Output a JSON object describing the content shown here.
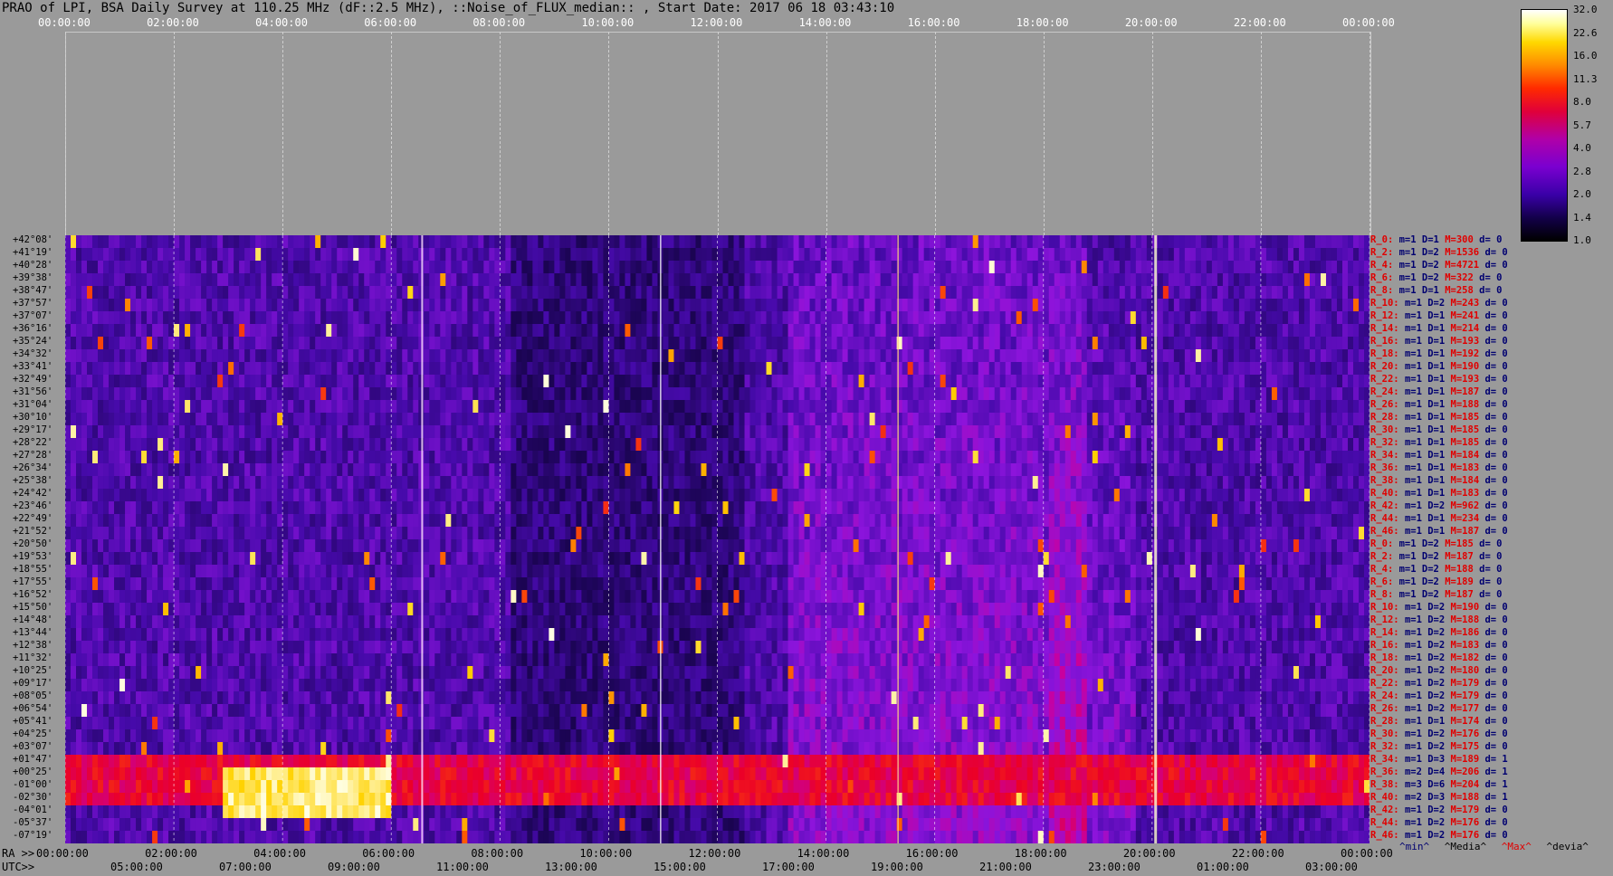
{
  "title": "PRAO of LPI, BSA Daily Survey at 110.25 MHz (dF::2.5 MHz), ::Noise_of_FLUX_median:: , Start Date: 2017 06 18 03:43:10",
  "colors": {
    "background": "#9a9a9a",
    "plot_bg": "#1a0650",
    "label_red": "#e00000",
    "label_blue": "#000070"
  },
  "chart_data": {
    "type": "heatmap",
    "top_axis_ticks": [
      "00:00:00",
      "02:00:00",
      "04:00:00",
      "06:00:00",
      "08:00:00",
      "10:00:00",
      "12:00:00",
      "14:00:00",
      "16:00:00",
      "18:00:00",
      "20:00:00",
      "22:00:00",
      "00:00:00"
    ],
    "ra_prefix": "RA >>",
    "ra_ticks": [
      "00:00:00",
      "02:00:00",
      "04:00:00",
      "06:00:00",
      "08:00:00",
      "10:00:00",
      "12:00:00",
      "14:00:00",
      "16:00:00",
      "18:00:00",
      "20:00:00",
      "22:00:00",
      "00:00:00"
    ],
    "utc_prefix": "UTC>>",
    "utc_ticks": [
      "05:00:00",
      "07:00:00",
      "09:00:00",
      "11:00:00",
      "13:00:00",
      "15:00:00",
      "17:00:00",
      "19:00:00",
      "21:00:00",
      "23:00:00",
      "01:00:00",
      "03:00:00"
    ],
    "color_scale": [
      "32.0",
      "22.6",
      "16.0",
      "11.3",
      "8.0",
      "5.7",
      "4.0",
      "2.8",
      "2.0",
      "1.4",
      "1.0"
    ],
    "declinations": [
      "+42°08'",
      "+41°19'",
      "+40°28'",
      "+39°38'",
      "+38°47'",
      "+37°57'",
      "+37°07'",
      "+36°16'",
      "+35°24'",
      "+34°32'",
      "+33°41'",
      "+32°49'",
      "+31°56'",
      "+31°04'",
      "+30°10'",
      "+29°17'",
      "+28°22'",
      "+27°28'",
      "+26°34'",
      "+25°38'",
      "+24°42'",
      "+23°46'",
      "+22°49'",
      "+21°52'",
      "+20°50'",
      "+19°53'",
      "+18°55'",
      "+17°55'",
      "+16°52'",
      "+15°50'",
      "+14°48'",
      "+13°44'",
      "+12°38'",
      "+11°32'",
      "+10°25'",
      "+09°17'",
      "+08°05'",
      "+06°54'",
      "+05°41'",
      "+04°25'",
      "+03°07'",
      "+01°47'",
      "+00°25'",
      "-01°00'",
      "-02°30'",
      "-04°01'",
      "-05°37'",
      "-07°19'"
    ],
    "row_stats": [
      {
        "r": "R_0:",
        "m": "m=1",
        "d": "D=1",
        "max": "M=300",
        "dev": "d= 0"
      },
      {
        "r": "R_2:",
        "m": "m=1",
        "d": "D=2",
        "max": "M=1536",
        "dev": "d= 0"
      },
      {
        "r": "R_4:",
        "m": "m=1",
        "d": "D=2",
        "max": "M=4721",
        "dev": "d= 0"
      },
      {
        "r": "R_6:",
        "m": "m=1",
        "d": "D=2",
        "max": "M=322",
        "dev": "d= 0"
      },
      {
        "r": "R_8:",
        "m": "m=1",
        "d": "D=1",
        "max": "M=258",
        "dev": "d= 0"
      },
      {
        "r": "R_10:",
        "m": "m=1",
        "d": "D=2",
        "max": "M=243",
        "dev": "d= 0"
      },
      {
        "r": "R_12:",
        "m": "m=1",
        "d": "D=1",
        "max": "M=241",
        "dev": "d= 0"
      },
      {
        "r": "R_14:",
        "m": "m=1",
        "d": "D=1",
        "max": "M=214",
        "dev": "d= 0"
      },
      {
        "r": "R_16:",
        "m": "m=1",
        "d": "D=1",
        "max": "M=193",
        "dev": "d= 0"
      },
      {
        "r": "R_18:",
        "m": "m=1",
        "d": "D=1",
        "max": "M=192",
        "dev": "d= 0"
      },
      {
        "r": "R_20:",
        "m": "m=1",
        "d": "D=1",
        "max": "M=190",
        "dev": "d= 0"
      },
      {
        "r": "R_22:",
        "m": "m=1",
        "d": "D=1",
        "max": "M=193",
        "dev": "d= 0"
      },
      {
        "r": "R_24:",
        "m": "m=1",
        "d": "D=1",
        "max": "M=187",
        "dev": "d= 0"
      },
      {
        "r": "R_26:",
        "m": "m=1",
        "d": "D=1",
        "max": "M=188",
        "dev": "d= 0"
      },
      {
        "r": "R_28:",
        "m": "m=1",
        "d": "D=1",
        "max": "M=185",
        "dev": "d= 0"
      },
      {
        "r": "R_30:",
        "m": "m=1",
        "d": "D=1",
        "max": "M=185",
        "dev": "d= 0"
      },
      {
        "r": "R_32:",
        "m": "m=1",
        "d": "D=1",
        "max": "M=185",
        "dev": "d= 0"
      },
      {
        "r": "R_34:",
        "m": "m=1",
        "d": "D=1",
        "max": "M=184",
        "dev": "d= 0"
      },
      {
        "r": "R_36:",
        "m": "m=1",
        "d": "D=1",
        "max": "M=183",
        "dev": "d= 0"
      },
      {
        "r": "R_38:",
        "m": "m=1",
        "d": "D=1",
        "max": "M=184",
        "dev": "d= 0"
      },
      {
        "r": "R_40:",
        "m": "m=1",
        "d": "D=1",
        "max": "M=183",
        "dev": "d= 0"
      },
      {
        "r": "R_42:",
        "m": "m=1",
        "d": "D=2",
        "max": "M=962",
        "dev": "d= 0"
      },
      {
        "r": "R_44:",
        "m": "m=1",
        "d": "D=1",
        "max": "M=234",
        "dev": "d= 0"
      },
      {
        "r": "R_46:",
        "m": "m=1",
        "d": "D=1",
        "max": "M=187",
        "dev": "d= 0"
      },
      {
        "r": "R_0:",
        "m": "m=1",
        "d": "D=2",
        "max": "M=185",
        "dev": "d= 0"
      },
      {
        "r": "R_2:",
        "m": "m=1",
        "d": "D=2",
        "max": "M=187",
        "dev": "d= 0"
      },
      {
        "r": "R_4:",
        "m": "m=1",
        "d": "D=2",
        "max": "M=188",
        "dev": "d= 0"
      },
      {
        "r": "R_6:",
        "m": "m=1",
        "d": "D=2",
        "max": "M=189",
        "dev": "d= 0"
      },
      {
        "r": "R_8:",
        "m": "m=1",
        "d": "D=2",
        "max": "M=187",
        "dev": "d= 0"
      },
      {
        "r": "R_10:",
        "m": "m=1",
        "d": "D=2",
        "max": "M=190",
        "dev": "d= 0"
      },
      {
        "r": "R_12:",
        "m": "m=1",
        "d": "D=2",
        "max": "M=188",
        "dev": "d= 0"
      },
      {
        "r": "R_14:",
        "m": "m=1",
        "d": "D=2",
        "max": "M=186",
        "dev": "d= 0"
      },
      {
        "r": "R_16:",
        "m": "m=1",
        "d": "D=2",
        "max": "M=183",
        "dev": "d= 0"
      },
      {
        "r": "R_18:",
        "m": "m=1",
        "d": "D=2",
        "max": "M=182",
        "dev": "d= 0"
      },
      {
        "r": "R_20:",
        "m": "m=1",
        "d": "D=2",
        "max": "M=180",
        "dev": "d= 0"
      },
      {
        "r": "R_22:",
        "m": "m=1",
        "d": "D=2",
        "max": "M=179",
        "dev": "d= 0"
      },
      {
        "r": "R_24:",
        "m": "m=1",
        "d": "D=2",
        "max": "M=179",
        "dev": "d= 0"
      },
      {
        "r": "R_26:",
        "m": "m=1",
        "d": "D=2",
        "max": "M=177",
        "dev": "d= 0"
      },
      {
        "r": "R_28:",
        "m": "m=1",
        "d": "D=1",
        "max": "M=174",
        "dev": "d= 0"
      },
      {
        "r": "R_30:",
        "m": "m=1",
        "d": "D=2",
        "max": "M=176",
        "dev": "d= 0"
      },
      {
        "r": "R_32:",
        "m": "m=1",
        "d": "D=2",
        "max": "M=175",
        "dev": "d= 0"
      },
      {
        "r": "R_34:",
        "m": "m=1",
        "d": "D=3",
        "max": "M=189",
        "dev": "d= 1"
      },
      {
        "r": "R_36:",
        "m": "m=2",
        "d": "D=4",
        "max": "M=206",
        "dev": "d= 1"
      },
      {
        "r": "R_38:",
        "m": "m=3",
        "d": "D=6",
        "max": "M=204",
        "dev": "d= 1"
      },
      {
        "r": "R_40:",
        "m": "m=2",
        "d": "D=3",
        "max": "M=188",
        "dev": "d= 1"
      },
      {
        "r": "R_42:",
        "m": "m=1",
        "d": "D=2",
        "max": "M=179",
        "dev": "d= 0"
      },
      {
        "r": "R_44:",
        "m": "m=1",
        "d": "D=2",
        "max": "M=176",
        "dev": "d= 0"
      },
      {
        "r": "R_46:",
        "m": "m=1",
        "d": "D=2",
        "max": "M=176",
        "dev": "d= 0"
      }
    ],
    "legend": {
      "min": "^min^",
      "median": "^Media^",
      "max": "^Max^",
      "dev": "^devia^"
    }
  }
}
